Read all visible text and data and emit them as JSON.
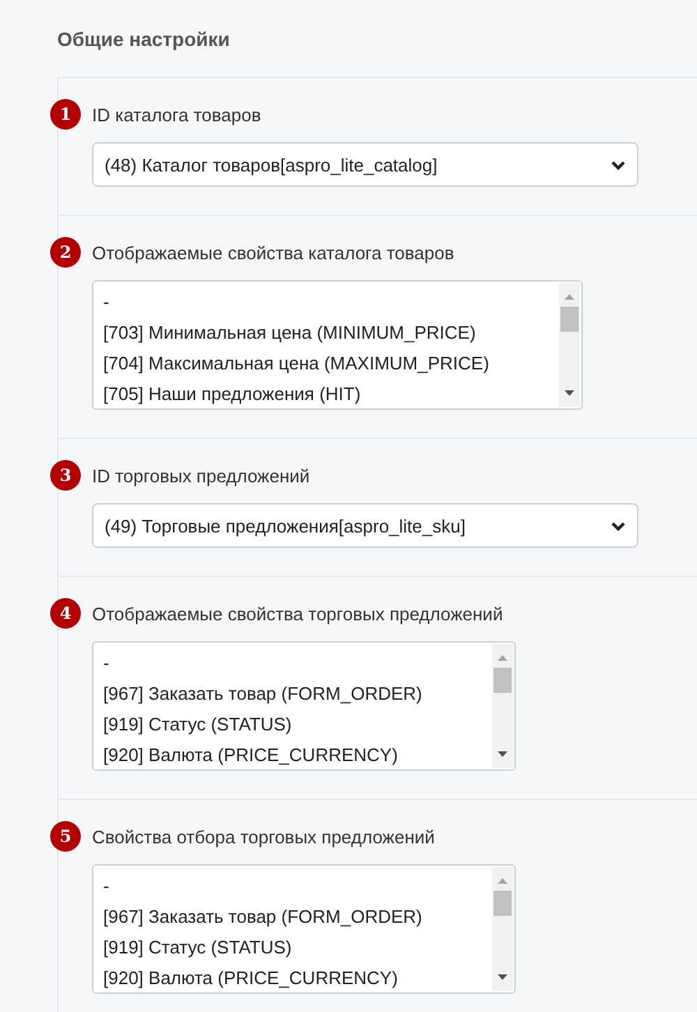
{
  "heading": "Общие настройки",
  "sections": [
    {
      "badge": "1",
      "label": "ID каталога товаров",
      "kind": "select",
      "value": "(48) Каталог товаров[aspro_lite_catalog]"
    },
    {
      "badge": "2",
      "label": "Отображаемые свойства каталога товаров",
      "kind": "listbox",
      "options": [
        "-",
        "[703] Минимальная цена (MINIMUM_PRICE)",
        "[704] Максимальная цена (MAXIMUM_PRICE)",
        "[705] Наши предложения (HIT)"
      ]
    },
    {
      "badge": "3",
      "label": "ID торговых предложений",
      "kind": "select",
      "value": "(49) Торговые предложения[aspro_lite_sku]"
    },
    {
      "badge": "4",
      "label": "Отображаемые свойства торговых предложений",
      "kind": "listbox",
      "options": [
        "-",
        "[967] Заказать товар (FORM_ORDER)",
        "[919] Статус (STATUS)",
        "[920] Валюта (PRICE_CURRENCY)"
      ]
    },
    {
      "badge": "5",
      "label": "Свойства отбора торговых предложений",
      "kind": "listbox",
      "options": [
        "-",
        "[967] Заказать товар (FORM_ORDER)",
        "[919] Статус (STATUS)",
        "[920] Валюта (PRICE_CURRENCY)"
      ]
    }
  ]
}
